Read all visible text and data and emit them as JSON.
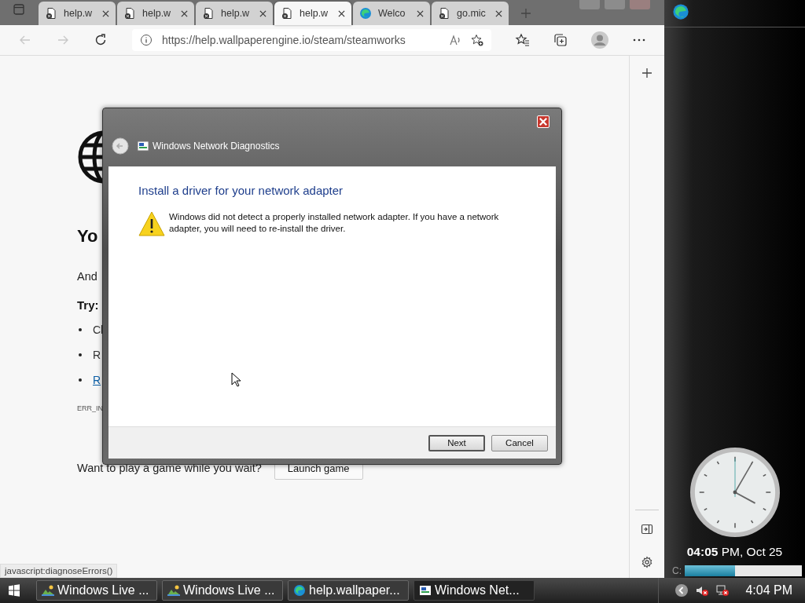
{
  "browser": {
    "tabs": [
      {
        "label": "help.w",
        "kind": "error",
        "selected": false
      },
      {
        "label": "help.w",
        "kind": "error",
        "selected": false
      },
      {
        "label": "help.w",
        "kind": "error",
        "selected": false
      },
      {
        "label": "help.w",
        "kind": "error",
        "selected": true
      },
      {
        "label": "Welco",
        "kind": "edge",
        "selected": false
      },
      {
        "label": "go.mic",
        "kind": "error",
        "selected": false
      }
    ],
    "address": "https://help.wallpaperengine.io/steam/steamworks",
    "page": {
      "heading": "Yo",
      "line": "And",
      "try": "Try:",
      "bullets": [
        {
          "text": "Cl",
          "kind": "text"
        },
        {
          "text": "R",
          "kind": "text"
        },
        {
          "text": "R",
          "kind": "link"
        }
      ],
      "error_code": "ERR_IN",
      "prompt": "Want to play a game while you wait?",
      "button": "Launch game"
    },
    "status_text": "javascript:diagnoseErrors()"
  },
  "dialog": {
    "title": "Windows Network Diagnostics",
    "heading": "Install a driver for your network adapter",
    "message": "Windows did not detect a properly installed network adapter. If you have a network adapter, you will need to re-install the driver.",
    "buttons": [
      {
        "label": "Next",
        "default": true
      },
      {
        "label": "Cancel",
        "default": false
      }
    ]
  },
  "sidebar": {
    "clock_text": "**04:05** PM, Oct 25",
    "drive": {
      "label": "C:",
      "level": 0.43
    }
  },
  "taskbar": {
    "items": [
      {
        "label": "Windows Live ...",
        "kind": "photo",
        "selected": false
      },
      {
        "label": "Windows Live ...",
        "kind": "photo",
        "selected": false
      },
      {
        "label": "help.wallpaper...",
        "kind": "edge",
        "selected": false
      },
      {
        "label": "Windows Net...",
        "kind": "network",
        "selected": true
      }
    ],
    "time": "4:04 PM"
  }
}
